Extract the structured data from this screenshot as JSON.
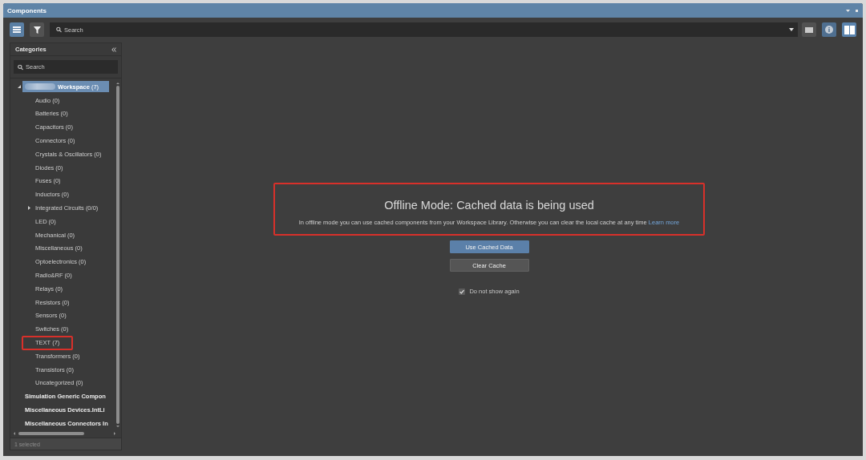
{
  "window": {
    "title": "Components"
  },
  "toolbar": {
    "left_buttons": [
      {
        "kind": "list",
        "selected": true
      },
      {
        "kind": "filter",
        "selected": false
      }
    ],
    "search": {
      "placeholder": "Search"
    },
    "right_buttons": [
      {
        "kind": "single",
        "selected": false
      },
      {
        "kind": "info",
        "selected": true
      },
      {
        "kind": "split",
        "selected": true
      }
    ]
  },
  "categories": {
    "title": "Categories",
    "search": {
      "placeholder": "Search"
    },
    "tree": [
      {
        "kind": "group",
        "label": "Workspace",
        "count": "(7)",
        "expanded": true,
        "selected": true,
        "annotated": false,
        "redacted": true,
        "children": [
          {
            "kind": "leaf",
            "label": "Audio",
            "count": "(0)",
            "selected": false,
            "annotated": false,
            "redacted": false
          },
          {
            "kind": "leaf",
            "label": "Batteries",
            "count": "(0)",
            "selected": false,
            "annotated": false,
            "redacted": false
          },
          {
            "kind": "leaf",
            "label": "Capacitors",
            "count": "(0)",
            "selected": false,
            "annotated": false,
            "redacted": false
          },
          {
            "kind": "leaf",
            "label": "Connectors",
            "count": "(0)",
            "selected": false,
            "annotated": false,
            "redacted": false
          },
          {
            "kind": "leaf",
            "label": "Crystals & Oscillators",
            "count": "(0)",
            "selected": false,
            "annotated": false,
            "redacted": false
          },
          {
            "kind": "leaf",
            "label": "Diodes",
            "count": "(0)",
            "selected": false,
            "annotated": false,
            "redacted": false
          },
          {
            "kind": "leaf",
            "label": "Fuses",
            "count": "(0)",
            "selected": false,
            "annotated": false,
            "redacted": false
          },
          {
            "kind": "leaf",
            "label": "Inductors",
            "count": "(0)",
            "selected": false,
            "annotated": false,
            "redacted": false
          },
          {
            "kind": "group",
            "label": "Integrated Circuits",
            "count": "(0/0)",
            "expanded": false,
            "selected": false,
            "annotated": false,
            "redacted": false
          },
          {
            "kind": "leaf",
            "label": "LED",
            "count": "(0)",
            "selected": false,
            "annotated": false,
            "redacted": false
          },
          {
            "kind": "leaf",
            "label": "Mechanical",
            "count": "(0)",
            "selected": false,
            "annotated": false,
            "redacted": false
          },
          {
            "kind": "leaf",
            "label": "Miscellaneous",
            "count": "(0)",
            "selected": false,
            "annotated": false,
            "redacted": false
          },
          {
            "kind": "leaf",
            "label": "Optoelectronics",
            "count": "(0)",
            "selected": false,
            "annotated": false,
            "redacted": false
          },
          {
            "kind": "leaf",
            "label": "Radio&RF",
            "count": "(0)",
            "selected": false,
            "annotated": false,
            "redacted": false
          },
          {
            "kind": "leaf",
            "label": "Relays",
            "count": "(0)",
            "selected": false,
            "annotated": false,
            "redacted": false
          },
          {
            "kind": "leaf",
            "label": "Resistors",
            "count": "(0)",
            "selected": false,
            "annotated": false,
            "redacted": false
          },
          {
            "kind": "leaf",
            "label": "Sensors",
            "count": "(0)",
            "selected": false,
            "annotated": false,
            "redacted": false
          },
          {
            "kind": "leaf",
            "label": "Switches",
            "count": "(0)",
            "selected": false,
            "annotated": false,
            "redacted": false
          },
          {
            "kind": "leaf",
            "label": "TEXT",
            "count": "(7)",
            "selected": false,
            "annotated": true,
            "redacted": false
          },
          {
            "kind": "leaf",
            "label": "Transformers",
            "count": "(0)",
            "selected": false,
            "annotated": false,
            "redacted": false
          },
          {
            "kind": "leaf",
            "label": "Transistors",
            "count": "(0)",
            "selected": false,
            "annotated": false,
            "redacted": false
          },
          {
            "kind": "leaf",
            "label": "Uncategorized",
            "count": "(0)",
            "selected": false,
            "annotated": false,
            "redacted": false
          }
        ]
      },
      {
        "kind": "library",
        "label": "Simulation Generic Compon",
        "selected": false,
        "annotated": false,
        "redacted": false
      },
      {
        "kind": "library",
        "label": "Miscellaneous Devices.IntLi",
        "selected": false,
        "annotated": false,
        "redacted": false
      },
      {
        "kind": "library",
        "label": "Miscellaneous Connectors In",
        "selected": false,
        "annotated": false,
        "redacted": false
      }
    ],
    "status": "1 selected"
  },
  "offline_notice": {
    "title": "Offline Mode: Cached data is being used",
    "message": "In offline mode you can use cached components from your Workspace Library. Otherwise you can clear the local cache at any time",
    "link": "Learn more",
    "annotated": true
  },
  "actions": [
    {
      "kind": "primary",
      "label": "Use Cached Data"
    },
    {
      "kind": "secondary",
      "label": "Clear Cache"
    }
  ],
  "do_not_show": {
    "label": "Do not show again",
    "checked": true
  }
}
